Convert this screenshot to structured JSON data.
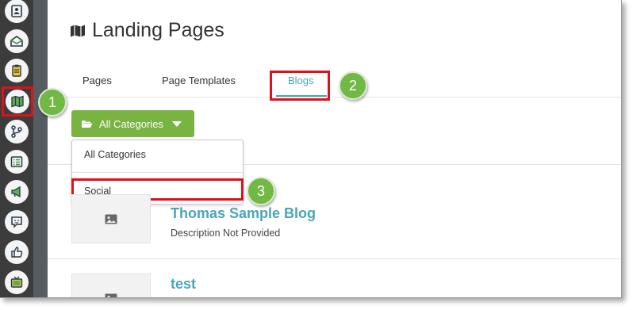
{
  "sidebar": {
    "items": [
      {
        "icon": "contact-card-icon",
        "selected": false
      },
      {
        "icon": "email-inbox-icon",
        "selected": false
      },
      {
        "icon": "clipboard-icon",
        "selected": false
      },
      {
        "icon": "map-icon",
        "selected": true
      },
      {
        "icon": "branch-icon",
        "selected": false
      },
      {
        "icon": "list-icon",
        "selected": false
      },
      {
        "icon": "megaphone-icon",
        "selected": false
      },
      {
        "icon": "chat-bubble-icon",
        "selected": false
      },
      {
        "icon": "thumbs-up-icon",
        "selected": false
      },
      {
        "icon": "tv-icon",
        "selected": false
      }
    ]
  },
  "page": {
    "title": "Landing Pages",
    "title_icon": "map-icon"
  },
  "tabs": [
    {
      "label": "Pages"
    },
    {
      "label": "Page Templates"
    },
    {
      "label": "Blogs",
      "active": true
    }
  ],
  "category_button": {
    "label": "All Categories",
    "icon": "folder-open-icon"
  },
  "dropdown": {
    "items": [
      "All Categories",
      "Social"
    ]
  },
  "blogs": [
    {
      "title": "Thomas Sample Blog",
      "description": "Description Not Provided"
    },
    {
      "title": "test",
      "description": ""
    }
  ],
  "callouts": [
    "1",
    "2",
    "3"
  ],
  "colors": {
    "accent": "#4aa5b8",
    "button": "#79b342",
    "highlight": "#e0101a",
    "callout": "#72b844",
    "sidebar": "#3c3c3c"
  }
}
